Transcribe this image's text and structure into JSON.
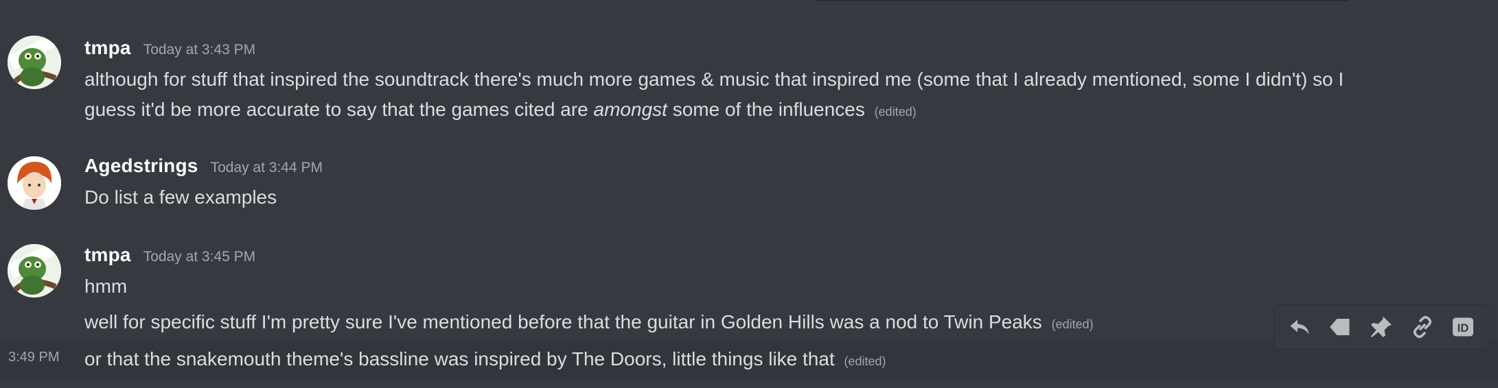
{
  "messages": [
    {
      "username": "tmpa",
      "timestamp": "Today at 3:43 PM",
      "lines": [
        {
          "text": "although for stuff that inspired the soundtrack there's much more games & music that inspired me (some that I already mentioned, some I didn't) so I",
          "edited": ""
        },
        {
          "text_before": "guess it'd be more accurate to say that the games cited are ",
          "text_italic": "amongst",
          "text_after": " some of the influences",
          "edited": "(edited)"
        }
      ]
    },
    {
      "username": "Agedstrings",
      "timestamp": "Today at 3:44 PM",
      "lines": [
        {
          "text": "Do list a few examples"
        }
      ]
    },
    {
      "username": "tmpa",
      "timestamp": "Today at 3:45 PM",
      "lines": [
        {
          "text": "hmm"
        },
        {
          "text": "well for specific stuff I'm pretty sure I've mentioned before that the guitar in Golden Hills was a nod to Twin Peaks",
          "edited": "(edited)"
        },
        {
          "text": "or that the snakemouth theme's bassline was inspired by The Doors, little things like that",
          "edited": "(edited)",
          "hover_time": "3:49 PM"
        }
      ]
    }
  ],
  "toolbar": {
    "icons": [
      "reply-icon",
      "tag-icon",
      "pin-icon",
      "link-icon",
      "id-icon"
    ],
    "id_label": "ID"
  },
  "colors": {
    "background": "#36393f",
    "username": "#ffffff",
    "text": "#dcddde",
    "muted": "#a3a6aa",
    "icon": "#b9bbbe"
  }
}
